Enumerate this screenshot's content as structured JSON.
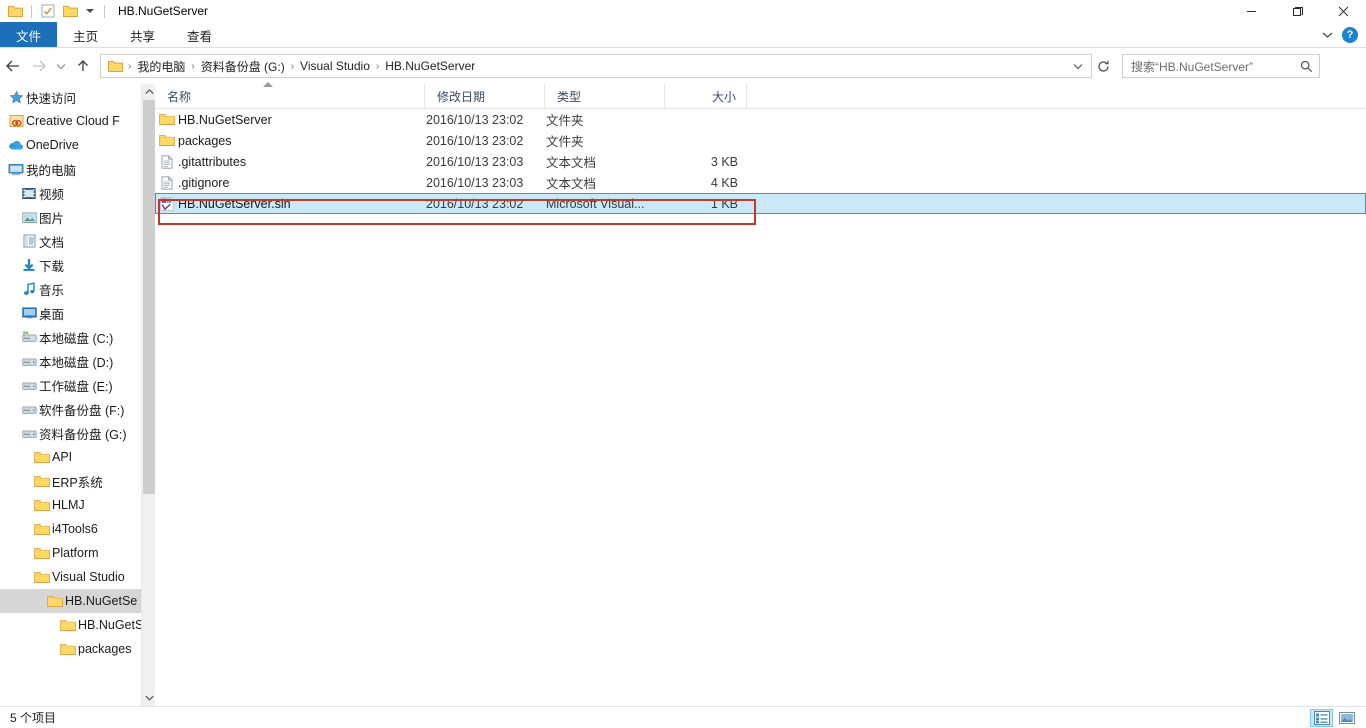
{
  "window": {
    "title": "HB.NuGetServer",
    "quick_access": [
      {
        "name": "folder-icon",
        "label": "文件夹"
      },
      {
        "name": "properties-icon",
        "label": "属性"
      },
      {
        "name": "new-folder-icon",
        "label": "新建文件夹"
      }
    ],
    "controls": {
      "minimize": "—",
      "maximize": "❐",
      "close": "✕"
    }
  },
  "ribbon": {
    "tabs": [
      {
        "label": "文件",
        "active": true
      },
      {
        "label": "主页",
        "active": false
      },
      {
        "label": "共享",
        "active": false
      },
      {
        "label": "查看",
        "active": false
      }
    ],
    "expand_label": "⌄",
    "help_label": "?"
  },
  "navigation": {
    "back_label": "←",
    "forward_label": "→",
    "recent_label": "⌄",
    "up_label": "↑",
    "breadcrumbs": [
      "我的电脑",
      "资料备份盘 (G:)",
      "Visual Studio",
      "HB.NuGetServer"
    ],
    "separator": "›",
    "dropdown_label": "⌄",
    "refresh_label": "↻"
  },
  "search": {
    "placeholder": "搜索“HB.NuGetServer”",
    "value": "",
    "icon": "search-icon"
  },
  "sidebar": {
    "items": [
      {
        "label": "快速访问",
        "icon": "star-icon",
        "indent": 0,
        "selected": false
      },
      {
        "label": "Creative Cloud F",
        "icon": "creative-cloud-icon",
        "indent": 0,
        "selected": false
      },
      {
        "label": "OneDrive",
        "icon": "cloud-icon",
        "indent": 0,
        "selected": false
      },
      {
        "label": "我的电脑",
        "icon": "computer-icon",
        "indent": 0,
        "selected": false
      },
      {
        "label": "视频",
        "icon": "video-icon",
        "indent": 1,
        "selected": false
      },
      {
        "label": "图片",
        "icon": "picture-icon",
        "indent": 1,
        "selected": false
      },
      {
        "label": "文档",
        "icon": "document-icon",
        "indent": 1,
        "selected": false
      },
      {
        "label": "下载",
        "icon": "download-icon",
        "indent": 1,
        "selected": false
      },
      {
        "label": "音乐",
        "icon": "music-icon",
        "indent": 1,
        "selected": false
      },
      {
        "label": "桌面",
        "icon": "desktop-icon",
        "indent": 1,
        "selected": false
      },
      {
        "label": "本地磁盘 (C:)",
        "icon": "system-drive-icon",
        "indent": 1,
        "selected": false
      },
      {
        "label": "本地磁盘 (D:)",
        "icon": "drive-icon",
        "indent": 1,
        "selected": false
      },
      {
        "label": "工作磁盘 (E:)",
        "icon": "drive-icon",
        "indent": 1,
        "selected": false
      },
      {
        "label": "软件备份盘 (F:)",
        "icon": "drive-icon",
        "indent": 1,
        "selected": false
      },
      {
        "label": "资料备份盘 (G:)",
        "icon": "drive-icon",
        "indent": 1,
        "selected": false
      },
      {
        "label": "API",
        "icon": "folder-icon",
        "indent": 2,
        "selected": false
      },
      {
        "label": "ERP系统",
        "icon": "folder-icon",
        "indent": 2,
        "selected": false
      },
      {
        "label": "HLMJ",
        "icon": "folder-icon",
        "indent": 2,
        "selected": false
      },
      {
        "label": "i4Tools6",
        "icon": "folder-icon",
        "indent": 2,
        "selected": false
      },
      {
        "label": "Platform",
        "icon": "folder-icon",
        "indent": 2,
        "selected": false
      },
      {
        "label": "Visual Studio",
        "icon": "folder-icon",
        "indent": 2,
        "selected": false
      },
      {
        "label": "HB.NuGetSe",
        "icon": "folder-icon",
        "indent": 3,
        "selected": true
      },
      {
        "label": "HB.NuGetS",
        "icon": "folder-icon",
        "indent": 4,
        "selected": false
      },
      {
        "label": "packages",
        "icon": "folder-icon",
        "indent": 4,
        "selected": false
      }
    ]
  },
  "filelist": {
    "columns": [
      {
        "label": "名称",
        "key": "name"
      },
      {
        "label": "修改日期",
        "key": "date"
      },
      {
        "label": "类型",
        "key": "type"
      },
      {
        "label": "大小",
        "key": "size"
      }
    ],
    "sort": {
      "column": "名称",
      "direction": "asc"
    },
    "rows": [
      {
        "name": "HB.NuGetServer",
        "date": "2016/10/13 23:02",
        "type": "文件夹",
        "size": "",
        "icon": "folder-icon",
        "selected": false
      },
      {
        "name": "packages",
        "date": "2016/10/13 23:02",
        "type": "文件夹",
        "size": "",
        "icon": "folder-icon",
        "selected": false
      },
      {
        "name": ".gitattributes",
        "date": "2016/10/13 23:03",
        "type": "文本文档",
        "size": "3 KB",
        "icon": "text-file-icon",
        "selected": false
      },
      {
        "name": ".gitignore",
        "date": "2016/10/13 23:03",
        "type": "文本文档",
        "size": "4 KB",
        "icon": "text-file-icon",
        "selected": false
      },
      {
        "name": "HB.NuGetServer.sln",
        "date": "2016/10/13 23:02",
        "type": "Microsoft Visual...",
        "size": "1 KB",
        "icon": "visual-studio-solution-icon",
        "selected": true
      }
    ]
  },
  "statusbar": {
    "item_count": "5 个项目",
    "views": [
      {
        "name": "details-view-button",
        "active": true
      },
      {
        "name": "large-icons-view-button",
        "active": false
      }
    ]
  },
  "annotation": {
    "color": "#c0392b",
    "target_row": "HB.NuGetServer.sln"
  }
}
